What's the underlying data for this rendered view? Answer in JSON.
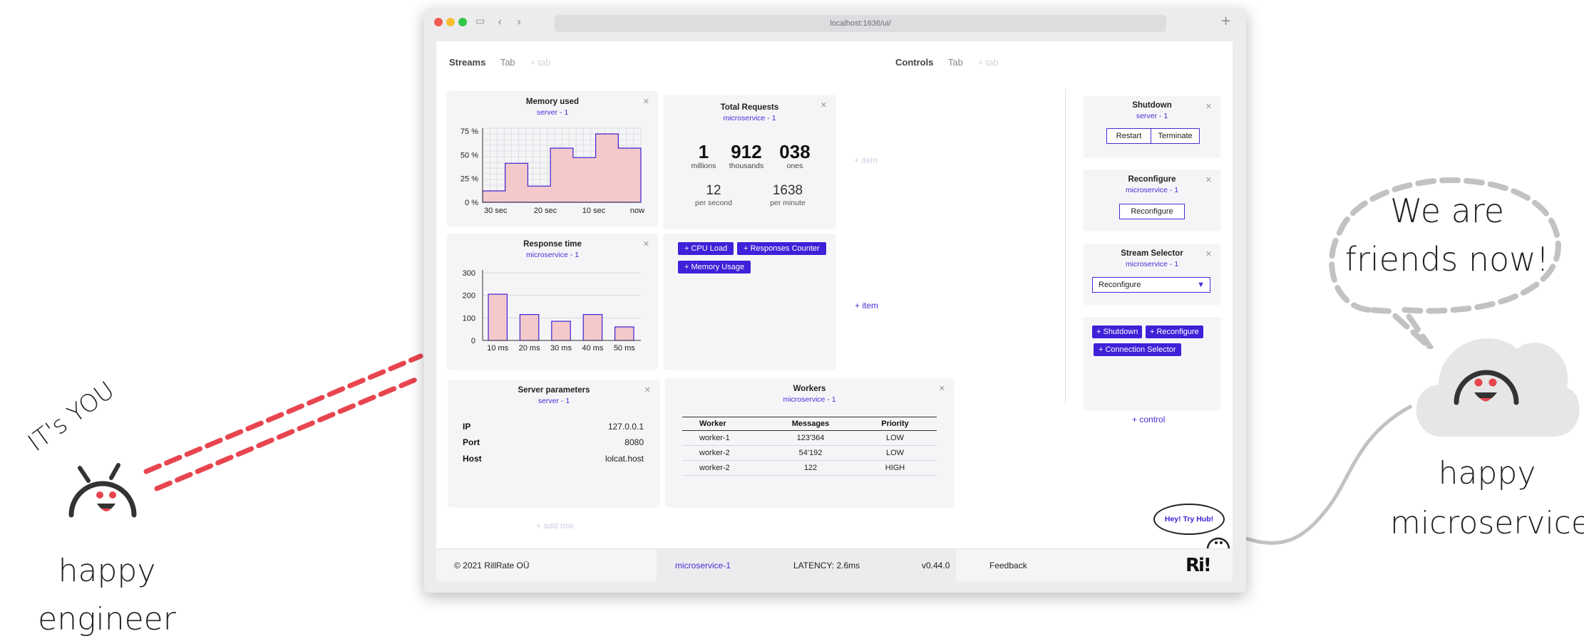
{
  "browser": {
    "url": "localhost:1636/ui/"
  },
  "left_tabs": {
    "active": "Streams",
    "tab": "Tab",
    "add": "+ tab"
  },
  "right_tabs": {
    "active": "Controls",
    "tab": "Tab",
    "add": "+ tab"
  },
  "memory_card": {
    "title": "Memory used",
    "subtitle": "server - 1",
    "chart_data": {
      "type": "area",
      "title": "Memory used",
      "y_ticks": [
        "75 %",
        "50 %",
        "25 %",
        "0 %"
      ],
      "x_ticks": [
        "30 sec",
        "20 sec",
        "10 sec",
        "now"
      ],
      "ylim": [
        0,
        75
      ],
      "step_values": [
        12,
        12,
        41,
        41,
        17,
        17,
        57,
        57,
        47,
        47,
        72,
        72,
        57,
        57
      ],
      "note_step": "step area, 14 samples over 30 sec"
    }
  },
  "requests_card": {
    "title": "Total Requests",
    "subtitle": "microservice - 1",
    "millions": "1",
    "millions_label": "millions",
    "thousands": "912",
    "thousands_label": "thousands",
    "ones": "038",
    "ones_label": "ones",
    "per_second": "12",
    "per_second_label": "per second",
    "per_minute": "1638",
    "per_minute_label": "per minute"
  },
  "response_card": {
    "title": "Response time",
    "subtitle": "microservice - 1",
    "chart_data": {
      "type": "bar",
      "categories": [
        "10 ms",
        "20 ms",
        "30 ms",
        "40 ms",
        "50 ms"
      ],
      "values": [
        205,
        115,
        85,
        115,
        60
      ],
      "y_ticks": [
        "300",
        "200",
        "100",
        "0"
      ],
      "ylim": [
        0,
        300
      ]
    }
  },
  "chips_card": {
    "chips": [
      "+ CPU Load",
      "+ Responses Counter",
      "+ Memory Usage"
    ]
  },
  "add_item_top": "+ item",
  "add_item": "+ item",
  "server_card": {
    "title": "Server parameters",
    "subtitle": "server - 1",
    "params": [
      {
        "key": "IP",
        "value": "127.0.0.1"
      },
      {
        "key": "Port",
        "value": "8080"
      },
      {
        "key": "Host",
        "value": "lolcat.host"
      }
    ]
  },
  "workers_card": {
    "title": "Workers",
    "subtitle": "microservice - 1",
    "columns": [
      "Worker",
      "Messages",
      "Priority"
    ],
    "rows": [
      [
        "worker-1",
        "123'364",
        "LOW"
      ],
      [
        "worker-2",
        "54'192",
        "LOW"
      ],
      [
        "worker-2",
        "122",
        "HIGH"
      ]
    ]
  },
  "add_row": "+ add row",
  "shutdown_card": {
    "title": "Shutdown",
    "subtitle": "server - 1",
    "restart": "Restart",
    "terminate": "Terminate"
  },
  "reconfigure_card": {
    "title": "Reconfigure",
    "subtitle": "microservice - 1",
    "button": "Reconfigure"
  },
  "selector_card": {
    "title": "Stream Selector",
    "subtitle": "microservice - 1",
    "selected": "Reconfigure"
  },
  "controls_chips": [
    "+ Shutdown",
    "+ Reconfigure",
    "+ Connection Selector"
  ],
  "add_control": "+ control",
  "hub_bubble": "Hey! Try Hub!",
  "footer": {
    "copyright": "© 2021 RillRate OÜ",
    "service": "microservice-1",
    "latency": "LATENCY: 2.6ms",
    "version": "v0.44.0",
    "feedback": "Feedback",
    "logo": "Ri!"
  },
  "decor": {
    "its_you": "IT's YOU",
    "engineer_line1": "happy",
    "engineer_line2": "engineer",
    "speech_line1": "We are",
    "speech_line2": "friends now!",
    "micro_line1": "happy",
    "micro_line2": "microservice"
  },
  "colors": {
    "accent": "#4020d8",
    "fill": "#f3c9cc",
    "dash_red": "#e8454f",
    "cloud": "#e6e6e6"
  }
}
